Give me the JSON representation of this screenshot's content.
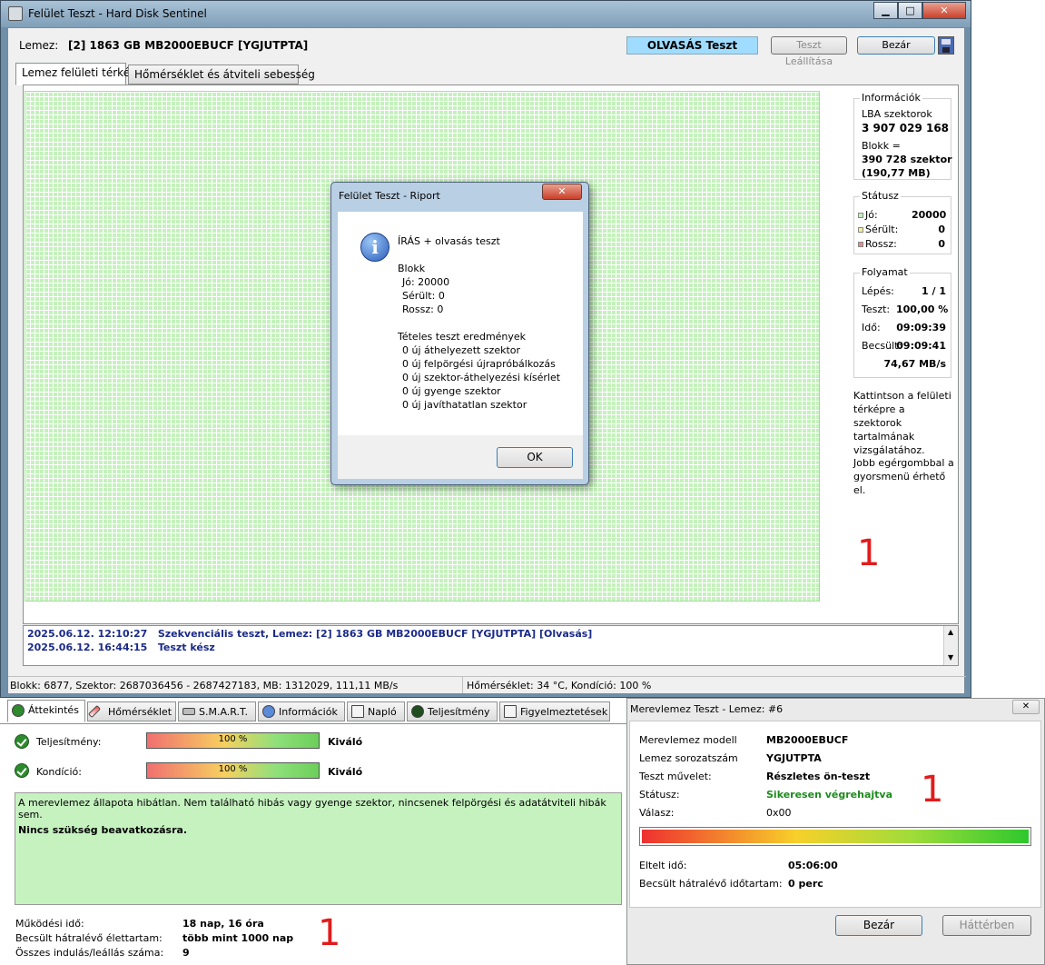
{
  "window": {
    "title": "Felület Teszt - Hard Disk Sentinel",
    "min": "▁",
    "max": "□",
    "close": "✕"
  },
  "header": {
    "disk_label": "Lemez:",
    "disk_value": "[2] 1863 GB  MB2000EBUCF [YGJUTPTA]",
    "test_mode": "OLVASÁS Teszt",
    "stop_button": "Teszt Leállítása",
    "close_button": "Bezár"
  },
  "tabs": [
    "Lemez felületi térkép",
    "Hőmérséklet és átviteli sebesség"
  ],
  "info": {
    "group": "Információk",
    "lba_label": "LBA szektorok",
    "lba_value": "3 907 029 168",
    "block_label": "Blokk =",
    "block_value": "390 728 szektor",
    "block_size": "(190,77 MB)"
  },
  "status": {
    "group": "Státusz",
    "good_label": "Jó:",
    "good_value": "20000",
    "damaged_label": "Sérült:",
    "damaged_value": "0",
    "bad_label": "Rossz:",
    "bad_value": "0"
  },
  "progress": {
    "group": "Folyamat",
    "step_label": "Lépés:",
    "step_value": "1 / 1",
    "test_label": "Teszt:",
    "test_value": "100,00 %",
    "time_label": "Idő:",
    "time_value": "09:09:39",
    "est_label": "Becsült:",
    "est_value": "09:09:41",
    "speed": "74,67 MB/s"
  },
  "hints": {
    "click": "Kattintson a felületi térképre a szektorok tartalmának vizsgálatához.",
    "right": "Jobb egérgombbal a gyorsmenü érhető el."
  },
  "log": [
    {
      "time": "2025.06.12.  12:10:27",
      "text": "Szekvenciális teszt, Lemez: [2] 1863 GB  MB2000EBUCF [YGJUTPTA] [Olvasás]"
    },
    {
      "time": "2025.06.12.  16:44:15",
      "text": "Teszt kész"
    }
  ],
  "statusbar": {
    "left": "Blokk: 6877, Szektor: 2687036456 - 2687427183, MB: 1312029, 111,11 MB/s",
    "right": "Hőmérséklet: 34  °C,  Kondíció: 100 %"
  },
  "dialog": {
    "title": "Felület Teszt - Riport",
    "heading": "ÍRÁS + olvasás teszt",
    "block": "Blokk",
    "good": "Jó: 20000",
    "damaged": "Sérült: 0",
    "bad": "Rossz: 0",
    "items_heading": "Tételes teszt eredmények",
    "items": [
      "0 új áthelyezett szektor",
      "0 új felpörgési újrapróbálkozás",
      "0 új szektor-áthelyezési kísérlet",
      "0 új gyenge szektor",
      "0 új javíthatatlan szektor"
    ],
    "ok": "OK"
  },
  "overview": {
    "tabs": [
      "Áttekintés",
      "Hőmérséklet",
      "S.M.A.R.T.",
      "Információk",
      "Napló",
      "Teljesítmény",
      "Figyelmeztetések"
    ],
    "perf_label": "Teljesítmény:",
    "perf_value": "100 %",
    "perf_percent": 100,
    "perf_rating": "Kiváló",
    "cond_label": "Kondíció:",
    "cond_value": "100 %",
    "cond_percent": 100,
    "cond_rating": "Kiváló",
    "message": "A merevlemez állapota hibátlan. Nem található hibás vagy gyenge szektor, nincsenek felpörgési és adatátviteli hibák sem.",
    "advice": "Nincs szükség beavatkozásra.",
    "uptime_label": "Működési idő:",
    "uptime_value": "18 nap, 16 óra",
    "life_label": "Becsült hátralévő élettartam:",
    "life_value": "több mint 1000 nap",
    "starts_label": "Összes indulás/leállás száma:",
    "starts_value": "9"
  },
  "selftest": {
    "title": "Merevlemez Teszt - Lemez: #6",
    "close": "✕",
    "model_label": "Merevlemez modell",
    "model_value": "MB2000EBUCF",
    "serial_label": "Lemez sorozatszám",
    "serial_value": "YGJUTPTA",
    "op_label": "Teszt művelet:",
    "op_value": "Részletes ön-teszt",
    "status_label": "Státusz:",
    "status_value": "Sikeresen végrehajtva",
    "answer_label": "Válasz:",
    "answer_value": "0x00",
    "elapsed_label": "Eltelt idő:",
    "elapsed_value": "05:06:00",
    "remaining_label": "Becsült hátralévő időtartam:",
    "remaining_value": "0 perc",
    "close_button": "Bezár",
    "background_button": "Háttérben",
    "progress_percent": 100
  },
  "annotations": [
    "1",
    "1",
    "1"
  ],
  "colors": {
    "good": "#c4f2bc",
    "status_ok": "#1e8a1e",
    "log_text": "#1a2a8a",
    "test_mode_bg": "#9fdcff",
    "annotation": "#e31b1b"
  }
}
